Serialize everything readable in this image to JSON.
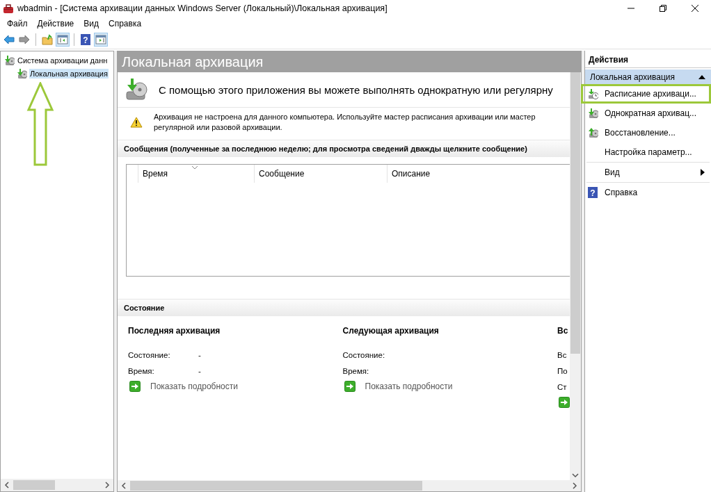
{
  "window": {
    "title": "wbadmin - [Система архивации данных Windows Server (Локальный)\\Локальная архивация]"
  },
  "menu": [
    "Файл",
    "Действие",
    "Вид",
    "Справка"
  ],
  "toolbar_groups": [
    {
      "buttons": [
        {
          "kind": "back",
          "pressed": false
        },
        {
          "kind": "forward",
          "pressed": false
        }
      ]
    },
    {
      "buttons": [
        {
          "kind": "up",
          "pressed": false
        },
        {
          "kind": "tree",
          "pressed": true
        }
      ]
    },
    {
      "buttons": [
        {
          "kind": "help",
          "pressed": false,
          "glyph": "?"
        },
        {
          "kind": "actions",
          "pressed": true
        }
      ]
    }
  ],
  "tree": [
    {
      "label": "Система архивации данн",
      "selected": false,
      "children": [
        {
          "label": "Локальная архивация",
          "selected": true
        }
      ]
    }
  ],
  "callouts": [
    {
      "kind": "up-arrow"
    }
  ],
  "main": {
    "title": "Локальная архивация",
    "intro": "С помощью этого приложения вы можете выполнять однократную или регулярну",
    "warning": [
      "Архивация не настроена для данного компьютера. Используйте мастер расписания архивации или мастер",
      "регулярной или разовой архивации."
    ],
    "messages": {
      "title": "Сообщения (полученные за последнюю неделю; для просмотра сведений дважды щелкните сообщение)",
      "columns": [
        {
          "label": "Время",
          "sorted": true
        },
        {
          "label": "Сообщение",
          "sorted": false
        },
        {
          "label": "Описание",
          "sorted": false
        }
      ]
    },
    "status": {
      "title": "Состояние",
      "columns": [
        {
          "heading": "Последняя архивация",
          "rows": [
            {
              "label": "Состояние:",
              "value": "-"
            },
            {
              "label": "Время:",
              "value": "-"
            }
          ],
          "link": "Показать подробности"
        },
        {
          "heading": "Следующая архивация",
          "rows": [
            {
              "label": "Состояние:"
            },
            {
              "label": "Время:"
            }
          ],
          "link": "Показать подробности"
        },
        {
          "heading": "Вс",
          "rows": [
            {
              "label": "Вс"
            },
            {
              "label": "По"
            },
            {
              "label": "Ст"
            }
          ]
        }
      ]
    }
  },
  "actions": {
    "title": "Действия",
    "sections": [
      {
        "title": "Локальная архивация",
        "expanded": true,
        "items": [
          {
            "label": "Расписание архиваци...",
            "kind": "schedule",
            "highlighted": true,
            "submenu": false
          },
          {
            "label": "Однократная архивац...",
            "kind": "backup",
            "highlighted": false,
            "submenu": false
          },
          {
            "label": "Восстановление...",
            "kind": "restore",
            "highlighted": false,
            "submenu": false
          },
          {
            "label": "Настройка параметр...",
            "kind": "plain",
            "highlighted": false,
            "submenu": false
          },
          {
            "label": "Вид",
            "kind": "plain",
            "highlighted": false,
            "submenu": true
          },
          {
            "label": "Справка",
            "kind": "help",
            "glyph": "?",
            "highlighted": false,
            "submenu": false
          }
        ]
      }
    ]
  }
}
